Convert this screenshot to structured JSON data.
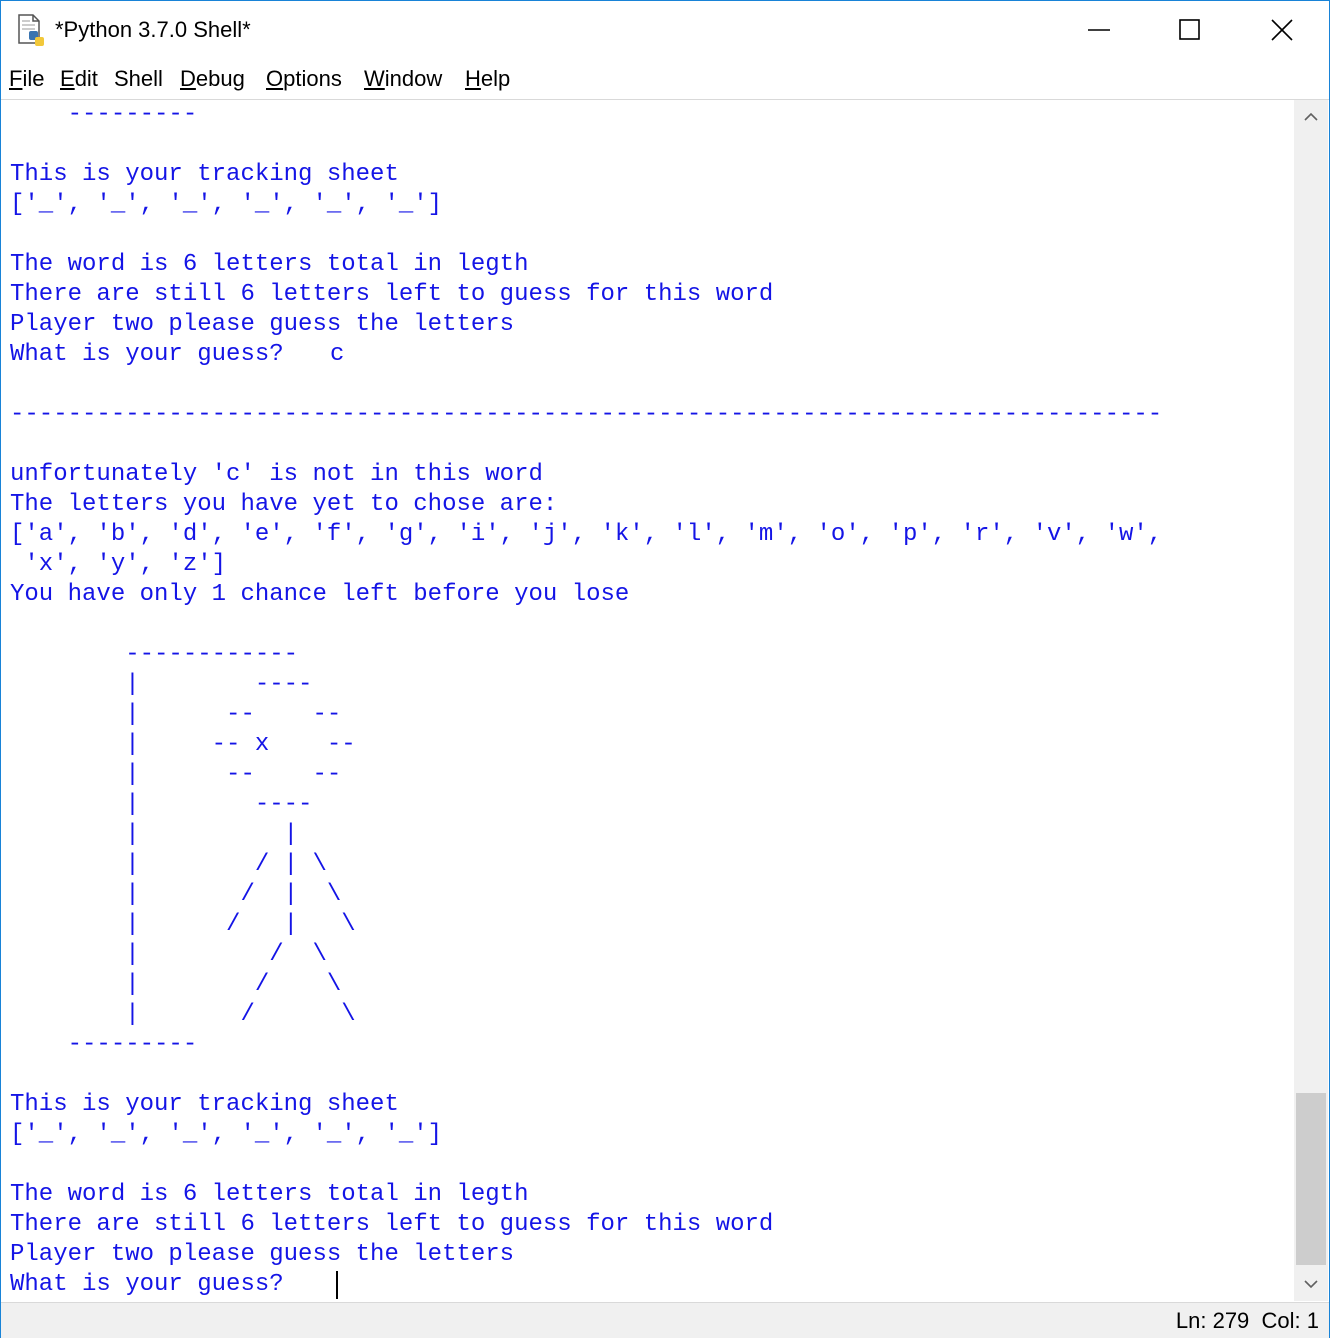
{
  "window": {
    "title": "*Python 3.7.0 Shell*"
  },
  "menu": [
    {
      "mnemonic": "F",
      "rest": "ile"
    },
    {
      "mnemonic": "E",
      "rest": "dit"
    },
    {
      "mnemonic": "",
      "rest": "Shell"
    },
    {
      "mnemonic": "D",
      "rest": "ebug"
    },
    {
      "mnemonic": "O",
      "rest": "ptions"
    },
    {
      "mnemonic": "W",
      "rest": "indow"
    },
    {
      "mnemonic": "H",
      "rest": "elp"
    }
  ],
  "shell": {
    "lines": [
      "    ---------",
      "",
      "This is your tracking sheet",
      "['_', '_', '_', '_', '_', '_']",
      "",
      "The word is 6 letters total in legth",
      "There are still 6 letters left to guess for this word",
      "Player two please guess the letters",
      "What is your guess? ",
      "",
      "--------------------------------------------------------------------------------",
      "",
      "unfortunately 'c' is not in this word",
      "The letters you have yet to chose are:",
      "['a', 'b', 'd', 'e', 'f', 'g', 'i', 'j', 'k', 'l', 'm', 'o', 'p', 'r', 'v', 'w',",
      " 'x', 'y', 'z']",
      "You have only 1 chance left before you lose",
      "",
      "        ------------",
      "        |        ----",
      "        |      --    --",
      "        |     -- x    --",
      "        |      --    --",
      "        |        ----",
      "        |          |",
      "        |        / | \\",
      "        |       /  |  \\",
      "        |      /   |   \\",
      "        |         /  \\",
      "        |        /    \\",
      "        |       /      \\",
      "    ---------",
      "",
      "This is your tracking sheet",
      "['_', '_', '_', '_', '_', '_']",
      "",
      "The word is 6 letters total in legth",
      "There are still 6 letters left to guess for this word",
      "Player two please guess the letters",
      "What is your guess? "
    ],
    "user_input": "c"
  },
  "status": {
    "text": "Ln: 279  Col: 1"
  }
}
